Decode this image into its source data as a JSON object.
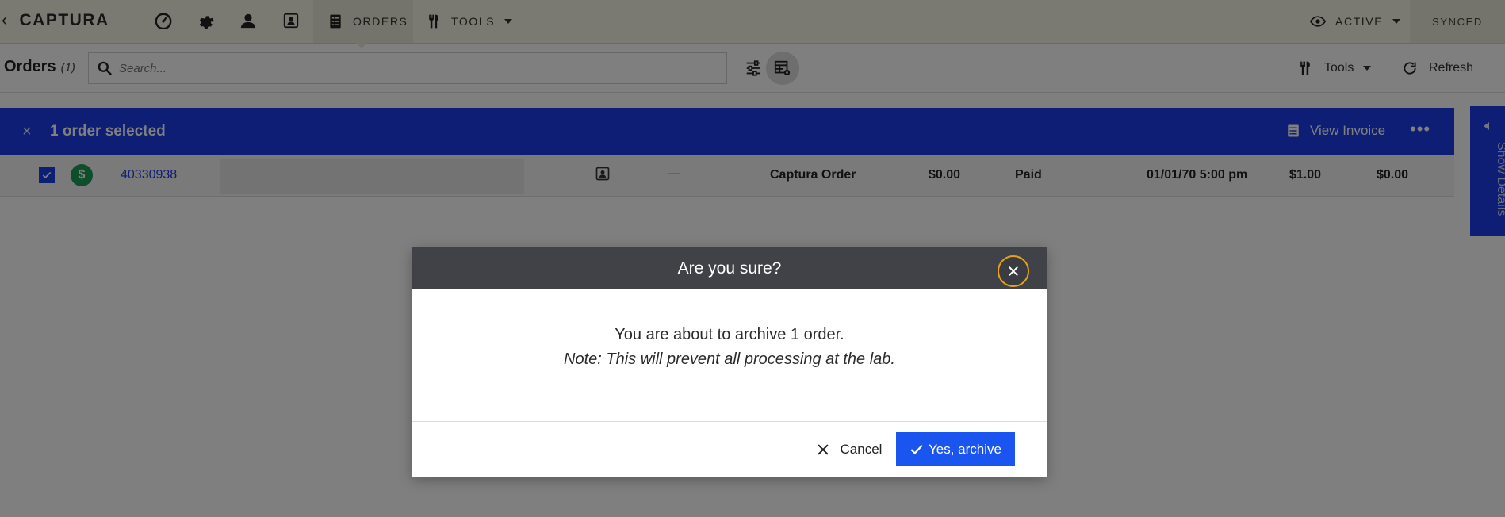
{
  "brand": {
    "name": "CAPTURA"
  },
  "nav": {
    "icons": [
      "dashboard-icon",
      "gear-icon",
      "user-icon",
      "contact-card-icon"
    ],
    "orders_label": "ORDERS",
    "tools_label": "TOOLS",
    "active_label": "ACTIVE",
    "synced_label": "SYNCED"
  },
  "toolbar": {
    "title": "Orders",
    "count": "(1)",
    "search_placeholder": "Search...",
    "tools_label": "Tools",
    "refresh_label": "Refresh"
  },
  "selection": {
    "close": "×",
    "title": "1 order selected",
    "view_invoice": "View Invoice",
    "more": "•••"
  },
  "row": {
    "dollar": "$",
    "order_number": "40330938",
    "dash": "—",
    "type": "Captura Order",
    "total": "$0.00",
    "status": "Paid",
    "date": "01/01/70 5:00 pm",
    "amount1": "$1.00",
    "amount2": "$0.00"
  },
  "side_panel": {
    "label": "Show Details"
  },
  "modal": {
    "title": "Are you sure?",
    "message": "You are about to archive 1 order.",
    "note": "Note: This will prevent all processing at the lab.",
    "cancel_label": "Cancel",
    "confirm_label": "Yes, archive"
  },
  "colors": {
    "accent": "#1a3ce8",
    "primary_button": "#1a55f0",
    "nav_bg": "#f4f3e4",
    "modal_header": "#414247",
    "focus_ring": "#e5a21a"
  }
}
